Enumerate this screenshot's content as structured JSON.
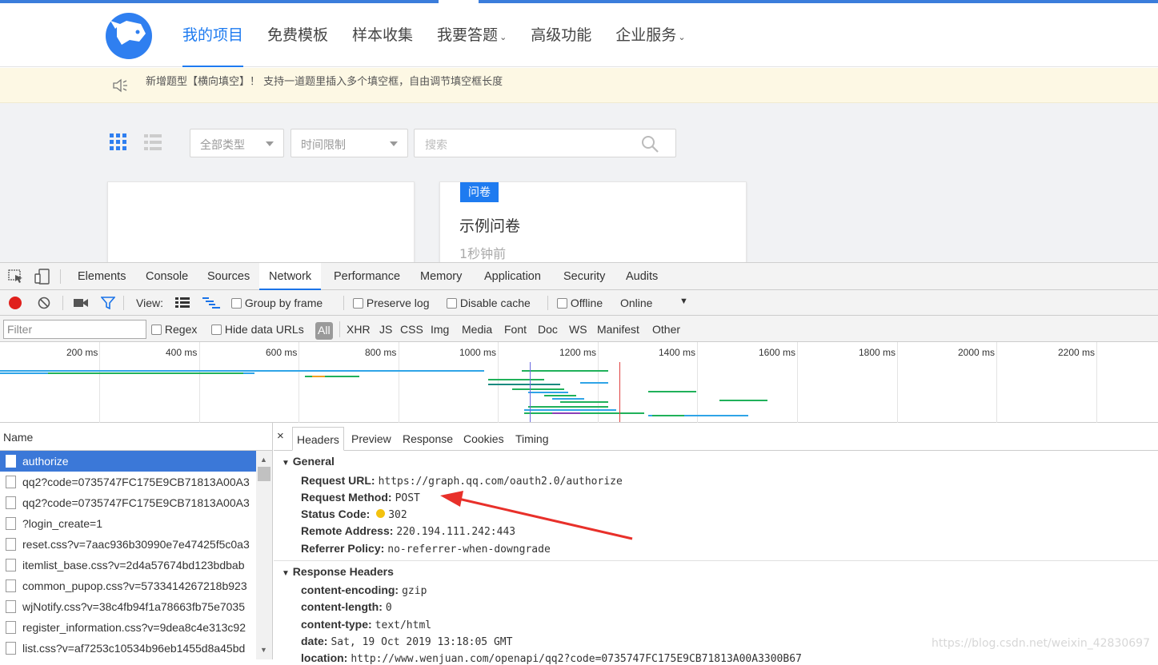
{
  "site": {
    "nav": [
      "我的项目",
      "免费模板",
      "样本收集",
      "我要答题",
      "高级功能",
      "企业服务"
    ],
    "notice": "新增题型【横向填空】！ 支持一道题里插入多个填空框，自由调节填空框长度",
    "filters": {
      "type": "全部类型",
      "time": "时间限制",
      "search_placeholder": "搜索"
    },
    "card": {
      "tag": "问卷",
      "title": "示例问卷",
      "time": "1秒钟前"
    }
  },
  "devtools": {
    "tabs": [
      "Elements",
      "Console",
      "Sources",
      "Network",
      "Performance",
      "Memory",
      "Application",
      "Security",
      "Audits"
    ],
    "toolbar": {
      "view": "View:",
      "group_by_frame": "Group by frame",
      "preserve_log": "Preserve log",
      "disable_cache": "Disable cache",
      "offline": "Offline",
      "online": "Online"
    },
    "filter": {
      "placeholder": "Filter",
      "regex": "Regex",
      "hide_data": "Hide data URLs",
      "all": "All",
      "types": [
        "XHR",
        "JS",
        "CSS",
        "Img",
        "Media",
        "Font",
        "Doc",
        "WS",
        "Manifest",
        "Other"
      ]
    },
    "timeline_ticks": [
      "200 ms",
      "400 ms",
      "600 ms",
      "800 ms",
      "1000 ms",
      "1200 ms",
      "1400 ms",
      "1600 ms",
      "1800 ms",
      "2000 ms",
      "2200 ms"
    ],
    "name_header": "Name",
    "requests": [
      "authorize",
      "qq2?code=0735747FC175E9CB71813A00A3",
      "qq2?code=0735747FC175E9CB71813A00A3",
      "?login_create=1",
      "reset.css?v=7aac936b30990e7e47425f5c0a3",
      "itemlist_base.css?v=2d4a57674bd123bdbab",
      "common_pupop.css?v=5733414267218b923",
      "wjNotify.css?v=38c4fb94f1a78663fb75e7035",
      "register_information.css?v=9dea8c4e313c92",
      "list.css?v=af7253c10534b96eb1455d8a45bd"
    ],
    "detail_tabs": [
      "Headers",
      "Preview",
      "Response",
      "Cookies",
      "Timing"
    ],
    "general": {
      "title": "General",
      "request_url_label": "Request URL:",
      "request_url": "https://graph.qq.com/oauth2.0/authorize",
      "method_label": "Request Method:",
      "method": "POST",
      "status_label": "Status Code:",
      "status": "302",
      "remote_label": "Remote Address:",
      "remote": "220.194.111.242:443",
      "referrer_label": "Referrer Policy:",
      "referrer": "no-referrer-when-downgrade"
    },
    "response_headers": {
      "title": "Response Headers",
      "items": [
        {
          "k": "content-encoding:",
          "v": "gzip"
        },
        {
          "k": "content-length:",
          "v": "0"
        },
        {
          "k": "content-type:",
          "v": "text/html"
        },
        {
          "k": "date:",
          "v": "Sat, 19 Oct 2019 13:18:05 GMT"
        },
        {
          "k": "location:",
          "v": "http://www.wenjuan.com/openapi/qq2?code=0735747FC175E9CB71813A00A3300B67"
        }
      ]
    }
  },
  "watermark": "https://blog.csdn.net/weixin_42830697"
}
